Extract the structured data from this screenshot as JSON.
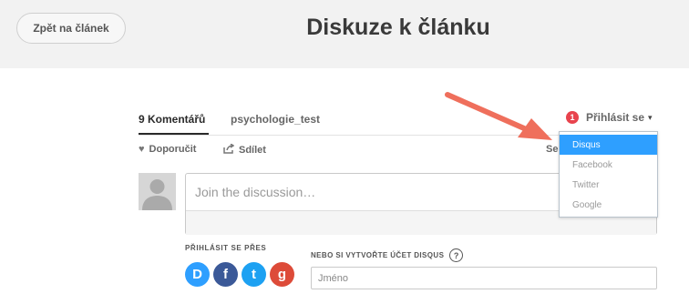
{
  "header": {
    "back_button": "Zpět na článek",
    "title": "Diskuze k článku"
  },
  "tabs": {
    "comments": "9 Komentářů",
    "forum": "psychologie_test"
  },
  "login": {
    "badge_count": "1",
    "label": "Přihlásit se",
    "caret": "▾"
  },
  "actions": {
    "recommend": "Doporučit",
    "share": "Sdílet",
    "sort_partial": "Se"
  },
  "composer": {
    "placeholder": "Join the discussion…"
  },
  "login_with": {
    "label": "PŘIHLÁSIT SE PŘES",
    "providers": [
      "D",
      "f",
      "t",
      "g"
    ]
  },
  "signup": {
    "label": "NEBO SI VYTVOŘTE ÚČET DISQUS",
    "help": "?",
    "name_placeholder": "Jméno"
  },
  "dropdown": {
    "items": [
      "Disqus",
      "Facebook",
      "Twitter",
      "Google"
    ],
    "selected": "Disqus"
  },
  "colors": {
    "accent_blue": "#2e9fff",
    "badge_red": "#e8434d",
    "arrow": "#ef6f5c",
    "disqus": "#2e9fff",
    "facebook": "#3b5998",
    "twitter": "#1da1f2",
    "google": "#dd4b39"
  }
}
